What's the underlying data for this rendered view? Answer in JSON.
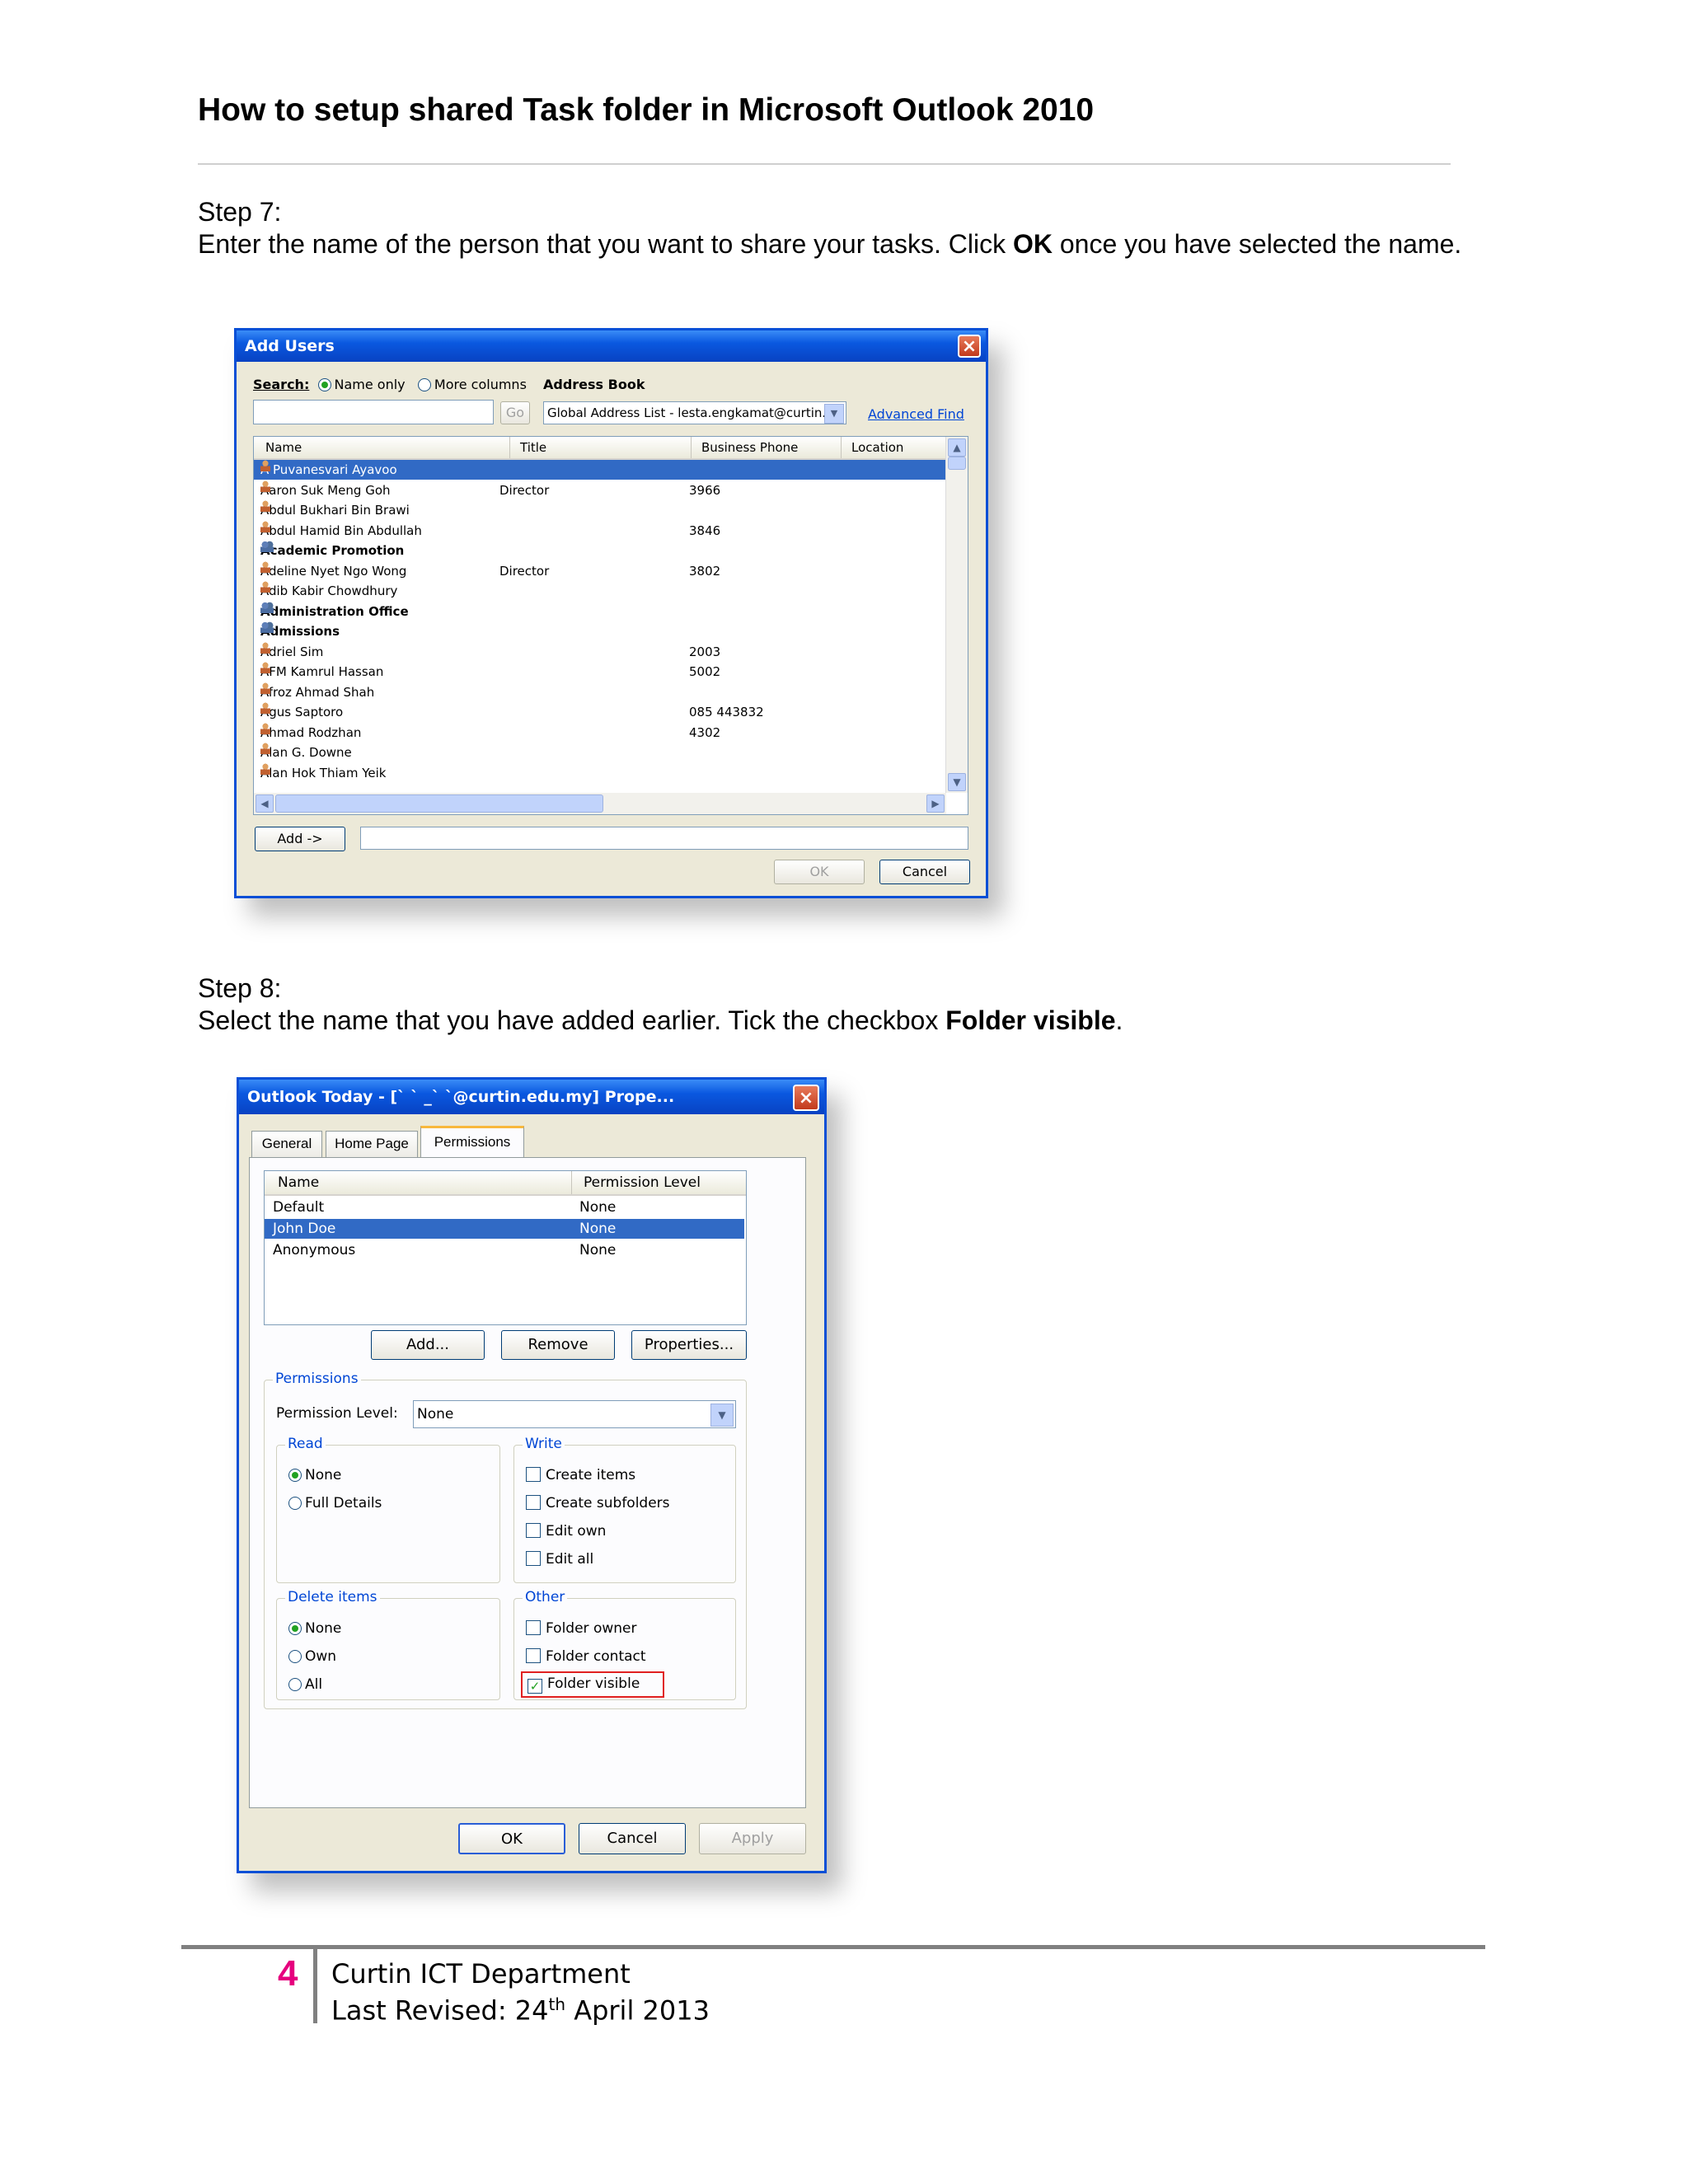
{
  "document": {
    "title": "How to setup shared Task folder in Microsoft Outlook 2010",
    "step7": {
      "heading": "Step 7:",
      "text_before": "Enter the name of the person that you want to share your tasks. Click ",
      "bold": "OK",
      "text_after": " once you have selected the name."
    },
    "step8": {
      "heading": "Step 8:",
      "text_before": "Select the name that you have added earlier. Tick the checkbox ",
      "bold": "Folder visible",
      "text_after": "."
    }
  },
  "add_users_dialog": {
    "title": "Add Users",
    "close_label": "×",
    "search_label": "Search:",
    "name_only": "Name only",
    "more_columns": "More columns",
    "address_book_label": "Address Book",
    "search_value": "",
    "go_label": "Go",
    "address_book_value": "Global Address List - lesta.engkamat@curtin.e",
    "advanced_find": "Advanced Find",
    "columns": [
      "Name",
      "Title",
      "Business Phone",
      "Location"
    ],
    "rows": [
      {
        "name": "A Puvanesvari Ayavoo",
        "title": "",
        "phone": "",
        "group": false
      },
      {
        "name": "Aaron Suk Meng Goh",
        "title": "Director",
        "phone": "3966",
        "group": false
      },
      {
        "name": "Abdul Bukhari Bin Brawi",
        "title": "",
        "phone": "",
        "group": false
      },
      {
        "name": "Abdul Hamid Bin Abdullah",
        "title": "",
        "phone": "3846",
        "group": false
      },
      {
        "name": "Academic Promotion",
        "title": "",
        "phone": "",
        "group": true
      },
      {
        "name": "Adeline Nyet Ngo Wong",
        "title": "Director",
        "phone": "3802",
        "group": false
      },
      {
        "name": "Adib Kabir Chowdhury",
        "title": "",
        "phone": "",
        "group": false
      },
      {
        "name": "Administration Office",
        "title": "",
        "phone": "",
        "group": true
      },
      {
        "name": "Admissions",
        "title": "",
        "phone": "",
        "group": true
      },
      {
        "name": "Adriel Sim",
        "title": "",
        "phone": "2003",
        "group": false
      },
      {
        "name": "AFM Kamrul Hassan",
        "title": "",
        "phone": "5002",
        "group": false
      },
      {
        "name": "Afroz Ahmad Shah",
        "title": "",
        "phone": "",
        "group": false
      },
      {
        "name": "Agus Saptoro",
        "title": "",
        "phone": "085 443832",
        "group": false
      },
      {
        "name": "Ahmad Rodzhan",
        "title": "",
        "phone": "4302",
        "group": false
      },
      {
        "name": "Alan G. Downe",
        "title": "",
        "phone": "",
        "group": false
      },
      {
        "name": "Alan Hok Thiam Yeik",
        "title": "",
        "phone": "",
        "group": false
      }
    ],
    "add_button": "Add ->",
    "added_value": "",
    "ok": "OK",
    "cancel": "Cancel"
  },
  "properties_dialog": {
    "title": "Outlook Today - [`    `    _`    `@curtin.edu.my] Prope...",
    "close_label": "×",
    "tabs": [
      "General",
      "Home Page",
      "Permissions"
    ],
    "columns": [
      "Name",
      "Permission Level"
    ],
    "rows": [
      {
        "name": "Default",
        "level": "None"
      },
      {
        "name": "John Doe",
        "level": "None"
      },
      {
        "name": "Anonymous",
        "level": "None"
      }
    ],
    "add": "Add...",
    "remove": "Remove",
    "properties": "Properties...",
    "permissions_group": "Permissions",
    "permission_level_label": "Permission Level:",
    "permission_level_value": "None",
    "read_group": "Read",
    "read_none": "None",
    "read_full": "Full Details",
    "write_group": "Write",
    "create_items": "Create items",
    "create_subfolders": "Create subfolders",
    "edit_own": "Edit own",
    "edit_all": "Edit all",
    "delete_group": "Delete items",
    "delete_none": "None",
    "delete_own": "Own",
    "delete_all": "All",
    "other_group": "Other",
    "folder_owner": "Folder owner",
    "folder_contact": "Folder contact",
    "folder_visible": "Folder visible",
    "checkmark": "✓",
    "ok": "OK",
    "cancel": "Cancel",
    "apply": "Apply"
  },
  "footer": {
    "page_number": "4",
    "department": "Curtin ICT Department",
    "revised_prefix": "Last Revised: 24",
    "revised_sup": "th",
    "revised_suffix": " April 2013"
  },
  "colors": {
    "selection": "#316ac5",
    "xp_title": "#0a58e0",
    "page_number": "#e6007e",
    "highlight_box": "#e02020"
  }
}
